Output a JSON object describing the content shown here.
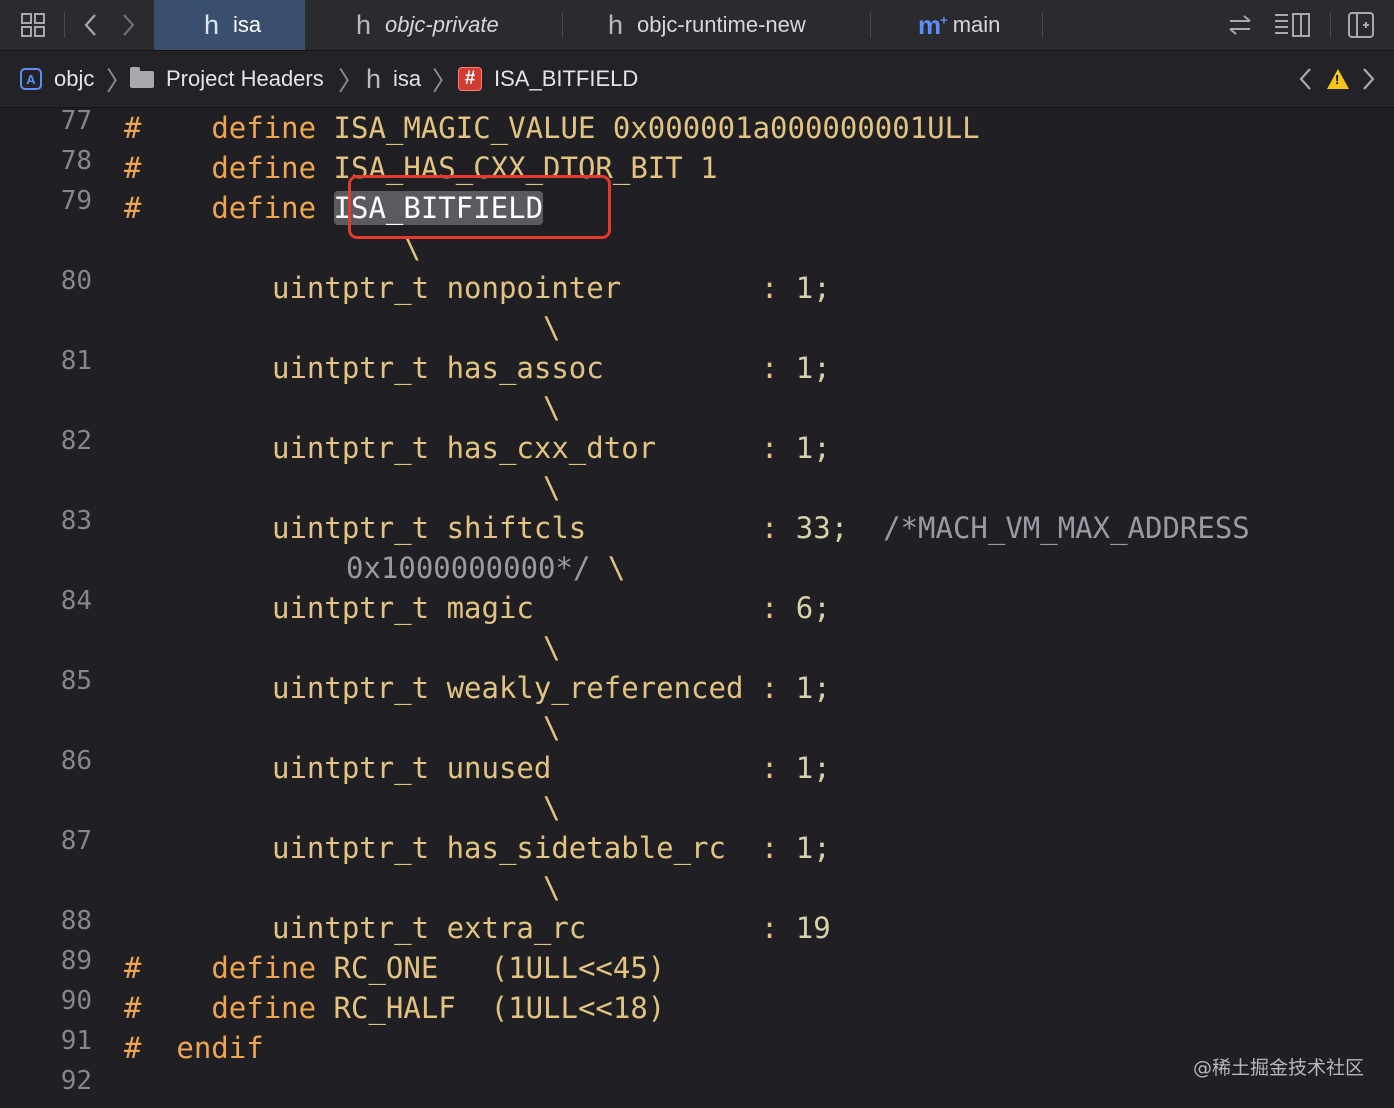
{
  "tabbar": {
    "tabs": [
      {
        "glyph": "h",
        "label": "isa",
        "active": true
      },
      {
        "glyph": "h",
        "label": "objc-private",
        "italic": true
      },
      {
        "glyph": "h",
        "label": "objc-runtime-new"
      },
      {
        "glyph": "m",
        "label": "main"
      }
    ]
  },
  "breadcrumb": {
    "items": [
      "objc",
      "Project Headers",
      "isa",
      "ISA_BITFIELD"
    ]
  },
  "editor": {
    "lines": [
      {
        "n": "77",
        "hash": "#",
        "indent": "    ",
        "kw": "define",
        "rest": " ISA_MAGIC_VALUE 0x000001a000000001ULL"
      },
      {
        "n": "78",
        "hash": "#",
        "indent": "    ",
        "kw": "define",
        "rest": " ISA_HAS_CXX_DTOR_BIT 1"
      },
      {
        "n": "79",
        "hash": "#",
        "indent": "    ",
        "kw": "define",
        "rest": " ",
        "highlight": "ISA_BITFIELD"
      },
      {
        "n": "",
        "cont": "                \\"
      },
      {
        "n": "80",
        "field": "uintptr_t nonpointer        ",
        "colon": ": ",
        "val": "1;"
      },
      {
        "n": "",
        "cont": "                        \\"
      },
      {
        "n": "81",
        "field": "uintptr_t has_assoc         ",
        "colon": ": ",
        "val": "1;"
      },
      {
        "n": "",
        "cont": "                        \\"
      },
      {
        "n": "82",
        "field": "uintptr_t has_cxx_dtor      ",
        "colon": ": ",
        "val": "1;"
      },
      {
        "n": "",
        "cont": "                        \\"
      },
      {
        "n": "83",
        "field": "uintptr_t shiftcls          ",
        "colon": ": ",
        "val": "33;",
        "comment": "  /*MACH_VM_MAX_ADDRESS"
      },
      {
        "n": "",
        "cont2a": "0x1000000000*/",
        "cont2b": " \\"
      },
      {
        "n": "84",
        "field": "uintptr_t magic             ",
        "colon": ": ",
        "val": "6;"
      },
      {
        "n": "",
        "cont": "                        \\"
      },
      {
        "n": "85",
        "field": "uintptr_t weakly_referenced ",
        "colon": ": ",
        "val": "1;"
      },
      {
        "n": "",
        "cont": "                        \\"
      },
      {
        "n": "86",
        "field": "uintptr_t unused            ",
        "colon": ": ",
        "val": "1;"
      },
      {
        "n": "",
        "cont": "                        \\"
      },
      {
        "n": "87",
        "field": "uintptr_t has_sidetable_rc  ",
        "colon": ": ",
        "val": "1;"
      },
      {
        "n": "",
        "cont": "                        \\"
      },
      {
        "n": "88",
        "field": "uintptr_t extra_rc          ",
        "colon": ": ",
        "val": "19"
      },
      {
        "n": "89",
        "hash": "#",
        "indent": "    ",
        "kw": "define",
        "rest": " RC_ONE   (1ULL<<45)"
      },
      {
        "n": "90",
        "hash": "#",
        "indent": "    ",
        "kw": "define",
        "rest": " RC_HALF  (1ULL<<18)"
      },
      {
        "n": "91",
        "hash": "#",
        "indent": "  ",
        "kw": "endif",
        "rest": ""
      },
      {
        "n": "92"
      }
    ]
  },
  "watermark": "@稀土掘金技术社区"
}
